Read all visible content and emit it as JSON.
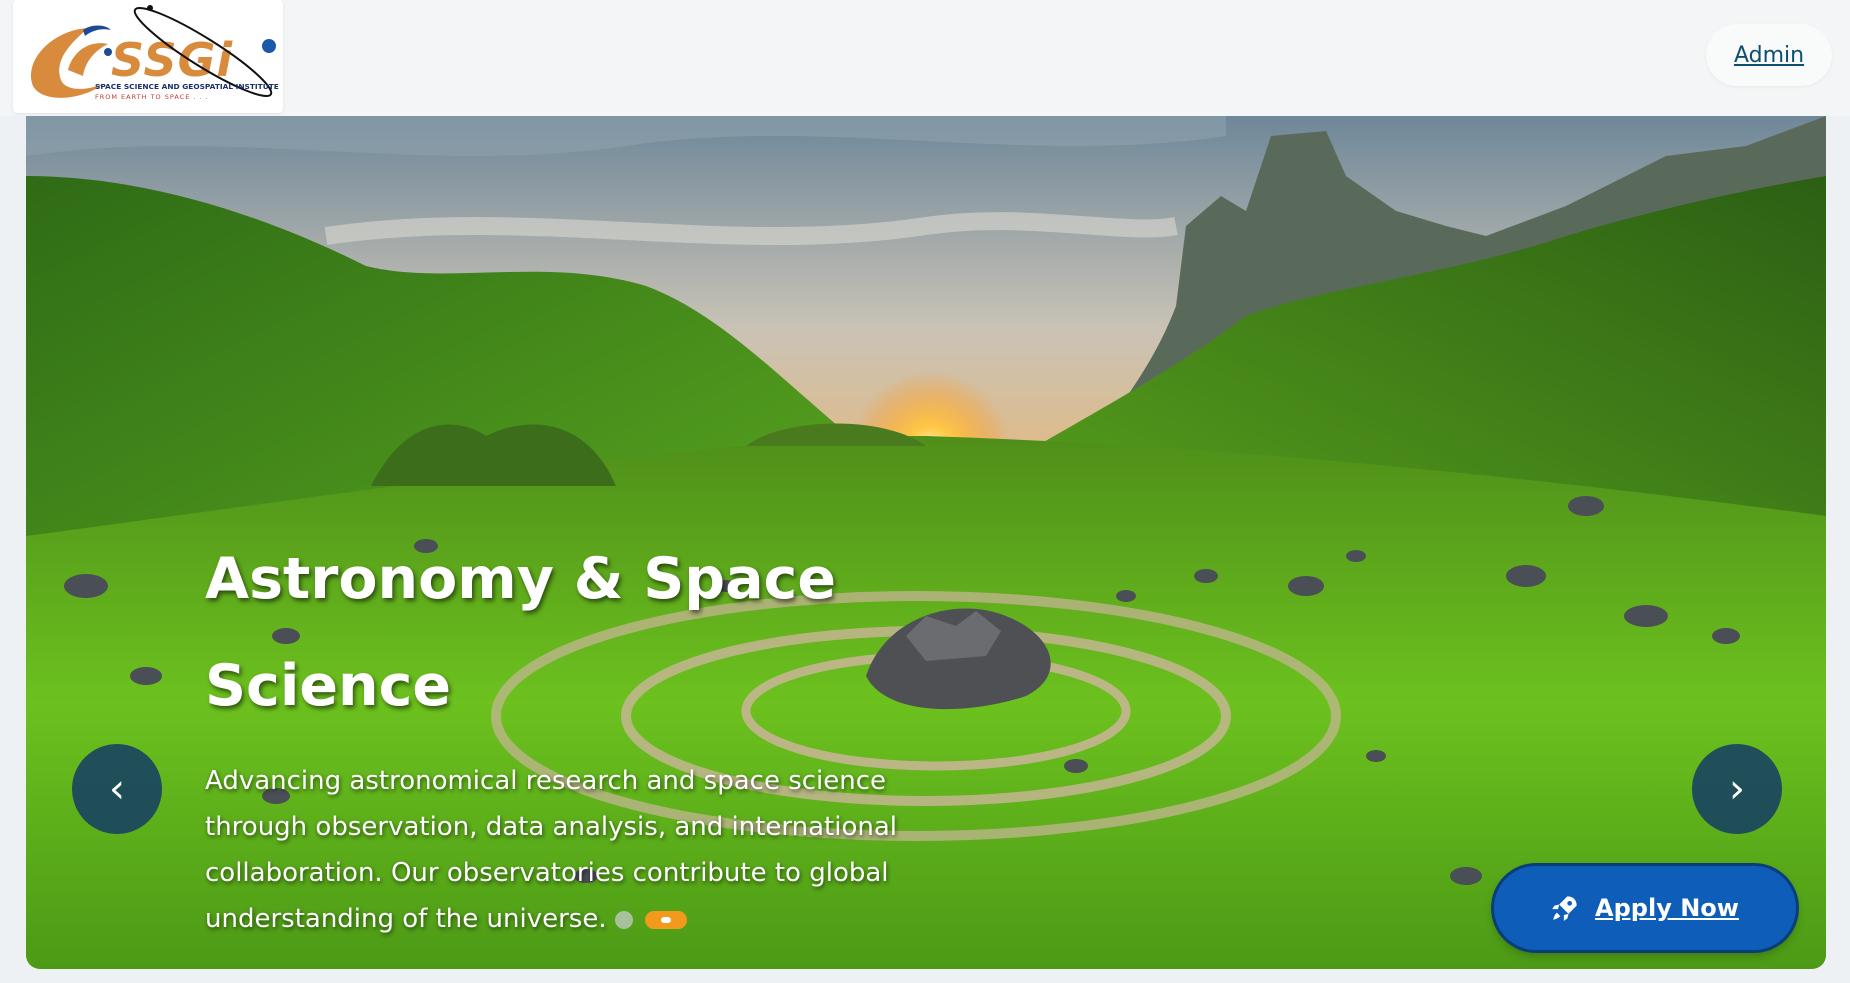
{
  "header": {
    "logo": {
      "brand": "SSGi",
      "institute": "SPACE SCIENCE AND GEOSPATIAL INSTITUTE",
      "tagline": "FROM EARTH TO SPACE . . ."
    },
    "admin_label": "Admin"
  },
  "hero": {
    "title": "Astronomy & Space Science",
    "description": "Advancing astronomical research and space science through observation, data analysis, and international collaboration. Our observatories contribute to global understanding of the universe.",
    "prev_symbol": "‹",
    "next_symbol": "›",
    "apply_label": "Apply Now",
    "slide_indicators": {
      "count": 2,
      "active_index": 1
    }
  },
  "colors": {
    "accent_orange": "#f39a1c",
    "link_blue": "#0d4f70",
    "apply_button": "#0e5db8",
    "nav_button": "#143c64"
  },
  "icons": {
    "apply": "rocket-icon",
    "prev": "chevron-left-icon",
    "next": "chevron-right-icon"
  }
}
